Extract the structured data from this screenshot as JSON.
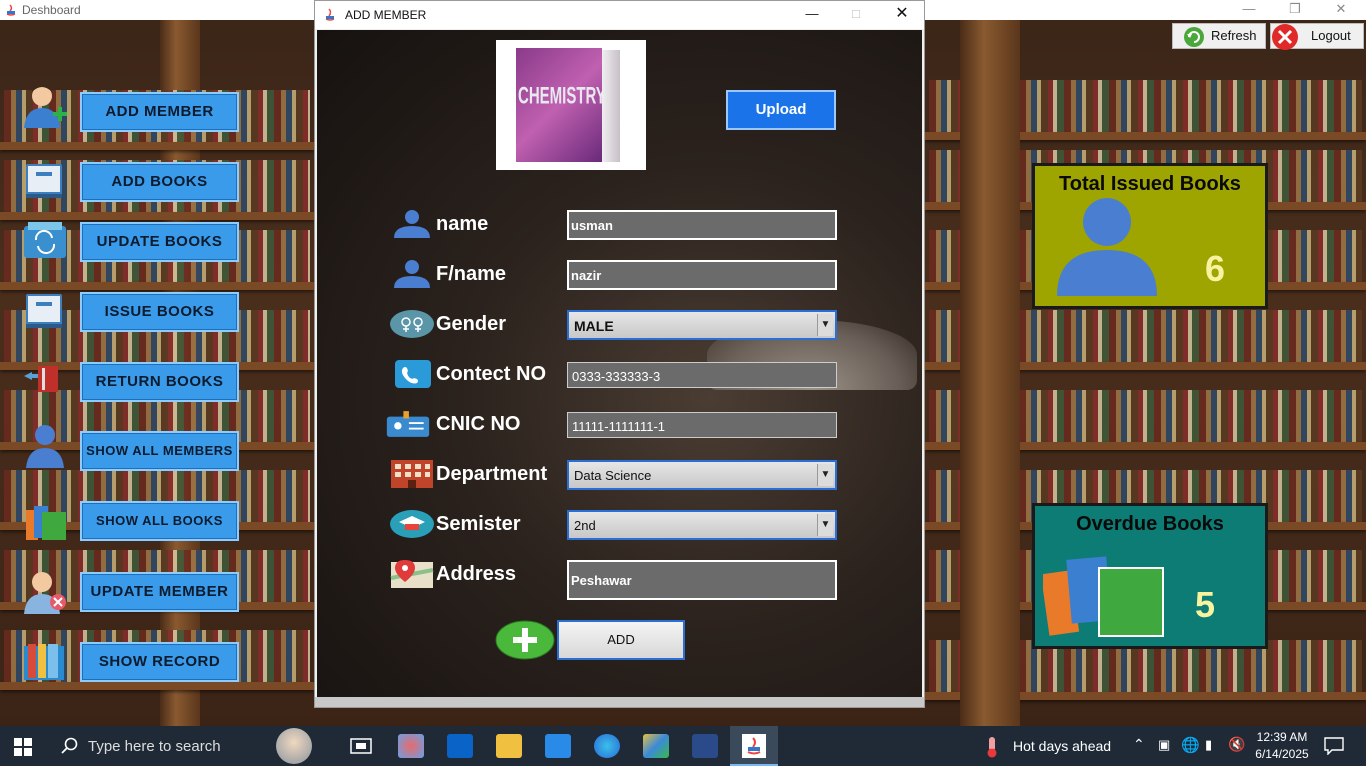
{
  "dashboard": {
    "title": "Deshboard",
    "refresh_label": "Refresh",
    "logout_label": "Logout",
    "menu": [
      {
        "label": "ADD MEMBER",
        "icon": "add-user-icon"
      },
      {
        "label": "ADD BOOKS",
        "icon": "book-icon"
      },
      {
        "label": "UPDATE BOOKS",
        "icon": "update-book-icon"
      },
      {
        "label": "ISSUE BOOKS",
        "icon": "book-icon"
      },
      {
        "label": "RETURN BOOKS",
        "icon": "return-book-icon"
      },
      {
        "label": "SHOW ALL MEMBERS",
        "icon": "user-icon"
      },
      {
        "label": "SHOW ALL BOOKS",
        "icon": "books-stack-icon"
      },
      {
        "label": "UPDATE MEMBER",
        "icon": "user-remove-icon"
      },
      {
        "label": "SHOW RECORD",
        "icon": "records-icon"
      }
    ],
    "cards": {
      "issued": {
        "title": "Total Issued Books",
        "value": "6",
        "color": "#9ea400"
      },
      "overdue": {
        "title": "Overdue Books",
        "value": "5",
        "color": "#0c7c74"
      }
    }
  },
  "dialog": {
    "title": "ADD MEMBER",
    "cover_text": "CHEMISTRY",
    "upload_label": "Upload",
    "add_label": "ADD",
    "fields": {
      "name": {
        "label": "name",
        "value": "usman"
      },
      "fname": {
        "label": "F/name",
        "value": "nazir"
      },
      "gender": {
        "label": "Gender",
        "value": "MALE"
      },
      "contact": {
        "label": "Contect NO",
        "value": "0333-333333-3"
      },
      "cnic": {
        "label": "CNIC NO",
        "value": "11111-1111111-1"
      },
      "department": {
        "label": "Department",
        "value": "Data Science"
      },
      "semester": {
        "label": "Semister",
        "value": "2nd"
      },
      "address": {
        "label": "Address",
        "value": "Peshawar"
      }
    }
  },
  "taskbar": {
    "search_placeholder": "Type here to search",
    "weather": "Hot days ahead",
    "time": "12:39 AM",
    "date": "6/14/2025"
  }
}
